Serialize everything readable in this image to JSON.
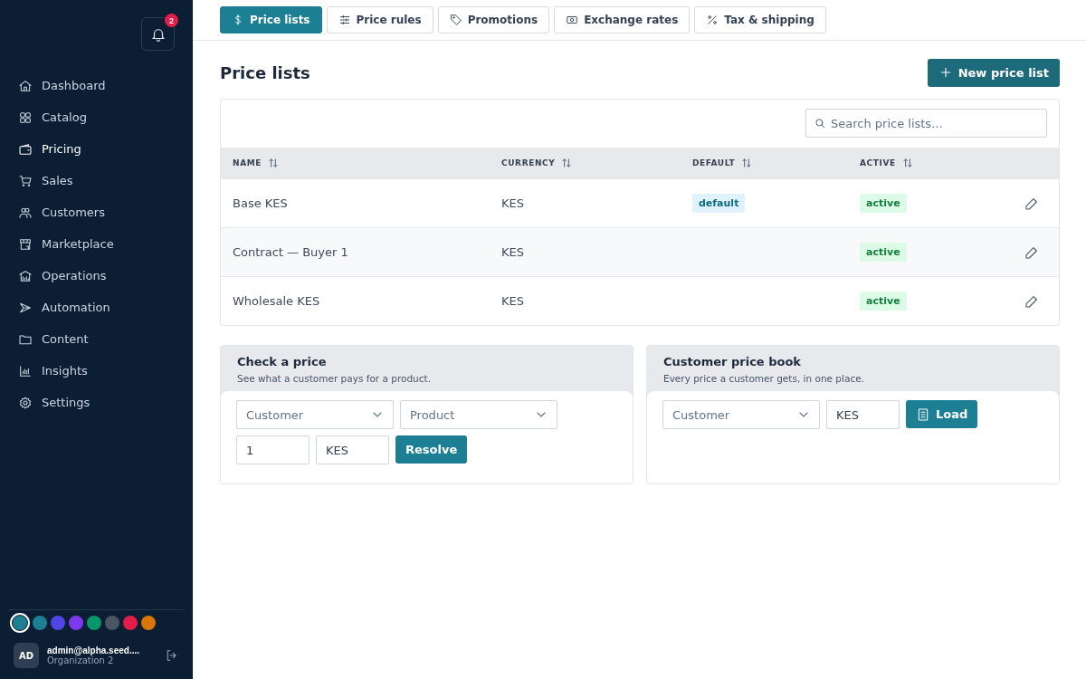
{
  "sidebar": {
    "notifications": {
      "count": "2"
    },
    "nav": [
      {
        "label": "Dashboard",
        "selected": false
      },
      {
        "label": "Catalog",
        "selected": false
      },
      {
        "label": "Pricing",
        "selected": true
      },
      {
        "label": "Sales",
        "selected": false
      },
      {
        "label": "Customers",
        "selected": false
      },
      {
        "label": "Marketplace",
        "selected": false
      },
      {
        "label": "Operations",
        "selected": false
      },
      {
        "label": "Automation",
        "selected": false
      },
      {
        "label": "Content",
        "selected": false
      },
      {
        "label": "Insights",
        "selected": false
      },
      {
        "label": "Settings",
        "selected": false
      }
    ],
    "themes": [
      {
        "color": "#1d7f93",
        "selected": true
      },
      {
        "color": "#1d7f93",
        "selected": false
      },
      {
        "color": "#4f46e5",
        "selected": false
      },
      {
        "color": "#7c3aed",
        "selected": false
      },
      {
        "color": "#059669",
        "selected": false
      },
      {
        "color": "#4b5563",
        "selected": false
      },
      {
        "color": "#e11d48",
        "selected": false
      },
      {
        "color": "#d97706",
        "selected": false
      }
    ],
    "user": {
      "initials": "AD",
      "email": "admin@alpha.seed....",
      "org": "Organization 2"
    }
  },
  "tabs": [
    {
      "label": "Price lists",
      "selected": true
    },
    {
      "label": "Price rules",
      "selected": false
    },
    {
      "label": "Promotions",
      "selected": false
    },
    {
      "label": "Exchange rates",
      "selected": false
    },
    {
      "label": "Tax & shipping",
      "selected": false
    }
  ],
  "page": {
    "title": "Price lists",
    "new_button": "New price list"
  },
  "table": {
    "search": {
      "placeholder": "Search price lists..."
    },
    "columns": [
      "NAME",
      "CURRENCY",
      "DEFAULT",
      "ACTIVE"
    ],
    "rows": [
      {
        "name": "Base KES",
        "currency": "KES",
        "default": "default",
        "active": "active"
      },
      {
        "name": "Contract — Buyer 1",
        "currency": "KES",
        "active": "active"
      },
      {
        "name": "Wholesale KES",
        "currency": "KES",
        "active": "active"
      }
    ]
  },
  "panels": [
    {
      "title": "Check a price",
      "subtitle": "See what a customer pays for a product.",
      "fields": [
        {
          "kind": "select",
          "placeholder": "Customer"
        },
        {
          "kind": "select",
          "placeholder": "Product"
        },
        {
          "kind": "break"
        },
        {
          "kind": "input",
          "value": "1"
        },
        {
          "kind": "input",
          "value": "KES"
        },
        {
          "kind": "button",
          "label": "Resolve"
        }
      ]
    },
    {
      "title": "Customer price book",
      "subtitle": "Every price a customer gets, in one place.",
      "fields": [
        {
          "kind": "select",
          "placeholder": "Customer"
        },
        {
          "kind": "input",
          "value": "KES"
        },
        {
          "kind": "iconbutton",
          "label": "Load"
        }
      ]
    }
  ]
}
